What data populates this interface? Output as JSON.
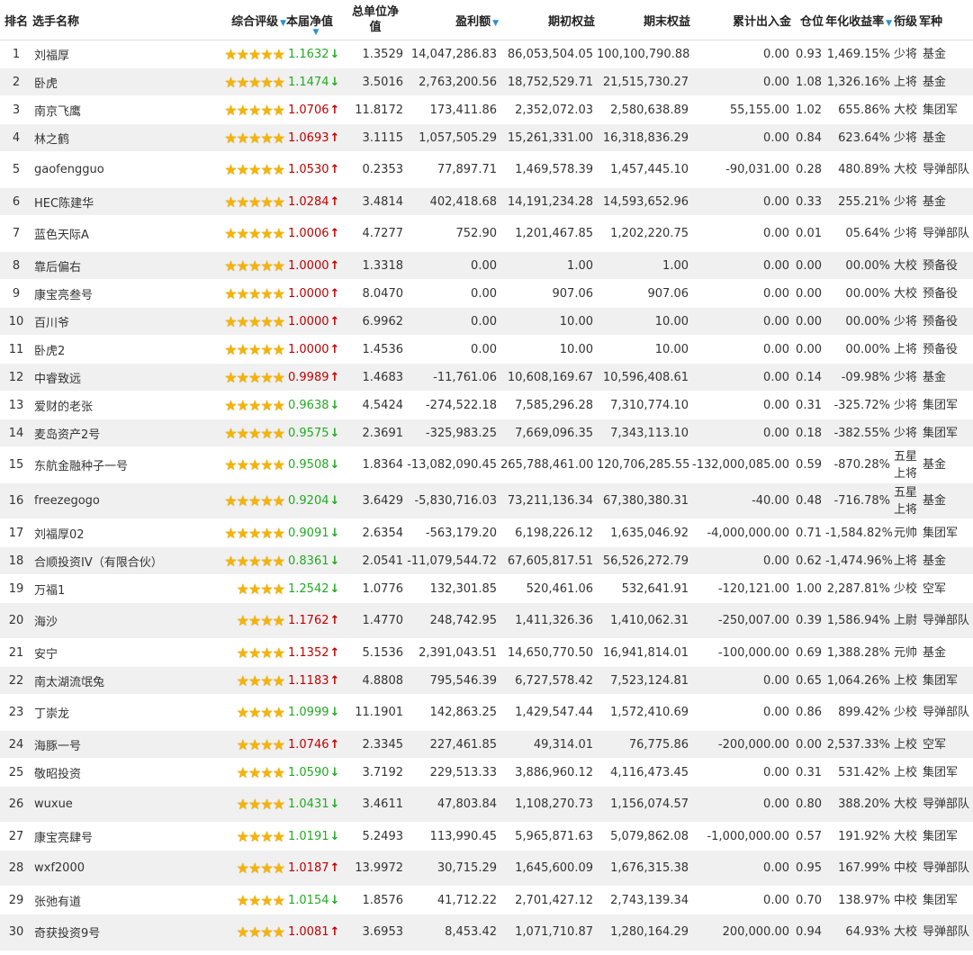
{
  "header": {
    "rank": "排名",
    "name": "选手名称",
    "rating": "综合评级",
    "nav": "本届净值",
    "total_nav_line1": "总单位净",
    "total_nav_line2": "值",
    "profit": "盈利额",
    "begin_equity": "期初权益",
    "end_equity": "期末权益",
    "cum_flow": "累计出入金",
    "position": "仓位",
    "annual_return": "年化收益率",
    "rank_title": "衔级",
    "branch": "军种",
    "sort_icon": "▼"
  },
  "colors": {
    "up": "#c00000",
    "down": "#22aa22",
    "star": "#f5b400",
    "stripe": "#f0f0f0",
    "sort": "#2a8fd8"
  },
  "rows": [
    {
      "rank": "1",
      "name": "刘福厚",
      "stars": 5,
      "nav": "1.1632",
      "dir": "down",
      "total_nav": "1.3529",
      "profit": "14,047,286.83",
      "begin": "86,053,504.05",
      "end": "100,100,790.88",
      "flow": "0.00",
      "position": "0.93",
      "annual": "1,469.15%",
      "title": "少将",
      "branch": "基金"
    },
    {
      "rank": "2",
      "name": "卧虎",
      "stars": 5,
      "nav": "1.1474",
      "dir": "down",
      "total_nav": "3.5016",
      "profit": "2,763,200.56",
      "begin": "18,752,529.71",
      "end": "21,515,730.27",
      "flow": "0.00",
      "position": "1.08",
      "annual": "1,326.16%",
      "title": "上将",
      "branch": "基金"
    },
    {
      "rank": "3",
      "name": "南京飞鹰",
      "stars": 5,
      "nav": "1.0706",
      "dir": "up",
      "total_nav": "11.8172",
      "profit": "173,411.86",
      "begin": "2,352,072.03",
      "end": "2,580,638.89",
      "flow": "55,155.00",
      "position": "1.02",
      "annual": "655.86%",
      "title": "大校",
      "branch": "集团军"
    },
    {
      "rank": "4",
      "name": "林之鹤",
      "stars": 5,
      "nav": "1.0693",
      "dir": "up",
      "total_nav": "3.1115",
      "profit": "1,057,505.29",
      "begin": "15,261,331.00",
      "end": "16,318,836.29",
      "flow": "0.00",
      "position": "0.84",
      "annual": "623.64%",
      "title": "少将",
      "branch": "基金"
    },
    {
      "rank": "5",
      "name": "gaofengguo",
      "stars": 5,
      "nav": "1.0530",
      "dir": "up",
      "total_nav": "0.2353",
      "profit": "77,897.71",
      "begin": "1,469,578.39",
      "end": "1,457,445.10",
      "flow": "-90,031.00",
      "position": "0.28",
      "annual": "480.89%",
      "title": "大校",
      "branch": "导弹部队"
    },
    {
      "rank": "6",
      "name": "HEC陈建华",
      "stars": 5,
      "nav": "1.0284",
      "dir": "up",
      "total_nav": "3.4814",
      "profit": "402,418.68",
      "begin": "14,191,234.28",
      "end": "14,593,652.96",
      "flow": "0.00",
      "position": "0.33",
      "annual": "255.21%",
      "title": "少将",
      "branch": "基金"
    },
    {
      "rank": "7",
      "name": "蓝色天际A",
      "stars": 5,
      "nav": "1.0006",
      "dir": "up",
      "total_nav": "4.7277",
      "profit": "752.90",
      "begin": "1,201,467.85",
      "end": "1,202,220.75",
      "flow": "0.00",
      "position": "0.01",
      "annual": "05.64%",
      "title": "少将",
      "branch": "导弹部队"
    },
    {
      "rank": "8",
      "name": "靠后偏右",
      "stars": 5,
      "nav": "1.0000",
      "dir": "up",
      "total_nav": "1.3318",
      "profit": "0.00",
      "begin": "1.00",
      "end": "1.00",
      "flow": "0.00",
      "position": "0.00",
      "annual": "00.00%",
      "title": "大校",
      "branch": "预备役"
    },
    {
      "rank": "9",
      "name": "康宝亮叁号",
      "stars": 5,
      "nav": "1.0000",
      "dir": "up",
      "total_nav": "8.0470",
      "profit": "0.00",
      "begin": "907.06",
      "end": "907.06",
      "flow": "0.00",
      "position": "0.00",
      "annual": "00.00%",
      "title": "大校",
      "branch": "预备役"
    },
    {
      "rank": "10",
      "name": "百川爷",
      "stars": 5,
      "nav": "1.0000",
      "dir": "up",
      "total_nav": "6.9962",
      "profit": "0.00",
      "begin": "10.00",
      "end": "10.00",
      "flow": "0.00",
      "position": "0.00",
      "annual": "00.00%",
      "title": "少将",
      "branch": "预备役"
    },
    {
      "rank": "11",
      "name": "卧虎2",
      "stars": 5,
      "nav": "1.0000",
      "dir": "up",
      "total_nav": "1.4536",
      "profit": "0.00",
      "begin": "10.00",
      "end": "10.00",
      "flow": "0.00",
      "position": "0.00",
      "annual": "00.00%",
      "title": "上将",
      "branch": "预备役"
    },
    {
      "rank": "12",
      "name": "中睿致远",
      "stars": 5,
      "nav": "0.9989",
      "dir": "up",
      "total_nav": "1.4683",
      "profit": "-11,761.06",
      "begin": "10,608,169.67",
      "end": "10,596,408.61",
      "flow": "0.00",
      "position": "0.14",
      "annual": "-09.98%",
      "title": "少将",
      "branch": "基金"
    },
    {
      "rank": "13",
      "name": "爱财的老张",
      "stars": 5,
      "nav": "0.9638",
      "dir": "down",
      "total_nav": "4.5424",
      "profit": "-274,522.18",
      "begin": "7,585,296.28",
      "end": "7,310,774.10",
      "flow": "0.00",
      "position": "0.31",
      "annual": "-325.72%",
      "title": "少将",
      "branch": "集团军"
    },
    {
      "rank": "14",
      "name": "麦岛资产2号",
      "stars": 5,
      "nav": "0.9575",
      "dir": "down",
      "total_nav": "2.3691",
      "profit": "-325,983.25",
      "begin": "7,669,096.35",
      "end": "7,343,113.10",
      "flow": "0.00",
      "position": "0.18",
      "annual": "-382.55%",
      "title": "少将",
      "branch": "集团军"
    },
    {
      "rank": "15",
      "name": "东航金融种子一号",
      "stars": 5,
      "nav": "0.9508",
      "dir": "down",
      "total_nav": "1.8364",
      "profit": "-13,082,090.45",
      "begin": "265,788,461.00",
      "end": "120,706,285.55",
      "flow": "-132,000,085.00",
      "position": "0.59",
      "annual": "-870.28%",
      "title": "五星上将",
      "branch": "基金"
    },
    {
      "rank": "16",
      "name": "freezegogo",
      "stars": 5,
      "nav": "0.9204",
      "dir": "down",
      "total_nav": "3.6429",
      "profit": "-5,830,716.03",
      "begin": "73,211,136.34",
      "end": "67,380,380.31",
      "flow": "-40.00",
      "position": "0.48",
      "annual": "-716.78%",
      "title": "五星上将",
      "branch": "基金"
    },
    {
      "rank": "17",
      "name": "刘福厚02",
      "stars": 5,
      "nav": "0.9091",
      "dir": "down",
      "total_nav": "2.6354",
      "profit": "-563,179.20",
      "begin": "6,198,226.12",
      "end": "1,635,046.92",
      "flow": "-4,000,000.00",
      "position": "0.71",
      "annual": "-1,584.82%",
      "title": "元帅",
      "branch": "集团军"
    },
    {
      "rank": "18",
      "name": "合顺投资IV（有限合伙）",
      "stars": 5,
      "nav": "0.8361",
      "dir": "down",
      "total_nav": "2.0541",
      "profit": "-11,079,544.72",
      "begin": "67,605,817.51",
      "end": "56,526,272.79",
      "flow": "0.00",
      "position": "0.62",
      "annual": "-1,474.96%",
      "title": "上将",
      "branch": "基金"
    },
    {
      "rank": "19",
      "name": "万福1",
      "stars": 4,
      "nav": "1.2542",
      "dir": "down",
      "total_nav": "1.0776",
      "profit": "132,301.85",
      "begin": "520,461.06",
      "end": "532,641.91",
      "flow": "-120,121.00",
      "position": "1.00",
      "annual": "2,287.81%",
      "title": "少校",
      "branch": "空军"
    },
    {
      "rank": "20",
      "name": "海沙",
      "stars": 4,
      "nav": "1.1762",
      "dir": "up",
      "total_nav": "1.4770",
      "profit": "248,742.95",
      "begin": "1,411,326.36",
      "end": "1,410,062.31",
      "flow": "-250,007.00",
      "position": "0.39",
      "annual": "1,586.94%",
      "title": "上尉",
      "branch": "导弹部队"
    },
    {
      "rank": "21",
      "name": "安宁",
      "stars": 4,
      "nav": "1.1352",
      "dir": "up",
      "total_nav": "5.1536",
      "profit": "2,391,043.51",
      "begin": "14,650,770.50",
      "end": "16,941,814.01",
      "flow": "-100,000.00",
      "position": "0.69",
      "annual": "1,388.28%",
      "title": "元帅",
      "branch": "基金"
    },
    {
      "rank": "22",
      "name": "南太湖流氓兔",
      "stars": 4,
      "nav": "1.1183",
      "dir": "up",
      "total_nav": "4.8808",
      "profit": "795,546.39",
      "begin": "6,727,578.42",
      "end": "7,523,124.81",
      "flow": "0.00",
      "position": "0.65",
      "annual": "1,064.26%",
      "title": "上校",
      "branch": "集团军"
    },
    {
      "rank": "23",
      "name": "丁崇龙",
      "stars": 4,
      "nav": "1.0999",
      "dir": "down",
      "total_nav": "11.1901",
      "profit": "142,863.25",
      "begin": "1,429,547.44",
      "end": "1,572,410.69",
      "flow": "0.00",
      "position": "0.86",
      "annual": "899.42%",
      "title": "少校",
      "branch": "导弹部队"
    },
    {
      "rank": "24",
      "name": "海豚一号",
      "stars": 4,
      "nav": "1.0746",
      "dir": "up",
      "total_nav": "2.3345",
      "profit": "227,461.85",
      "begin": "49,314.01",
      "end": "76,775.86",
      "flow": "-200,000.00",
      "position": "0.00",
      "annual": "2,537.33%",
      "title": "上校",
      "branch": "空军"
    },
    {
      "rank": "25",
      "name": "敬昭投资",
      "stars": 4,
      "nav": "1.0590",
      "dir": "down",
      "total_nav": "3.7192",
      "profit": "229,513.33",
      "begin": "3,886,960.12",
      "end": "4,116,473.45",
      "flow": "0.00",
      "position": "0.31",
      "annual": "531.42%",
      "title": "上校",
      "branch": "集团军"
    },
    {
      "rank": "26",
      "name": "wuxue",
      "stars": 4,
      "nav": "1.0431",
      "dir": "down",
      "total_nav": "3.4611",
      "profit": "47,803.84",
      "begin": "1,108,270.73",
      "end": "1,156,074.57",
      "flow": "0.00",
      "position": "0.80",
      "annual": "388.20%",
      "title": "大校",
      "branch": "导弹部队"
    },
    {
      "rank": "27",
      "name": "康宝亮肆号",
      "stars": 4,
      "nav": "1.0191",
      "dir": "down",
      "total_nav": "5.2493",
      "profit": "113,990.45",
      "begin": "5,965,871.63",
      "end": "5,079,862.08",
      "flow": "-1,000,000.00",
      "position": "0.57",
      "annual": "191.92%",
      "title": "大校",
      "branch": "集团军"
    },
    {
      "rank": "28",
      "name": "wxf2000",
      "stars": 4,
      "nav": "1.0187",
      "dir": "up",
      "total_nav": "13.9972",
      "profit": "30,715.29",
      "begin": "1,645,600.09",
      "end": "1,676,315.38",
      "flow": "0.00",
      "position": "0.95",
      "annual": "167.99%",
      "title": "中校",
      "branch": "导弹部队"
    },
    {
      "rank": "29",
      "name": "张弛有道",
      "stars": 4,
      "nav": "1.0154",
      "dir": "down",
      "total_nav": "1.8576",
      "profit": "41,712.22",
      "begin": "2,701,427.12",
      "end": "2,743,139.34",
      "flow": "0.00",
      "position": "0.70",
      "annual": "138.97%",
      "title": "中校",
      "branch": "集团军"
    },
    {
      "rank": "30",
      "name": "奇获投资9号",
      "stars": 4,
      "nav": "1.0081",
      "dir": "up",
      "total_nav": "3.6953",
      "profit": "8,453.42",
      "begin": "1,071,710.87",
      "end": "1,280,164.29",
      "flow": "200,000.00",
      "position": "0.94",
      "annual": "64.93%",
      "title": "大校",
      "branch": "导弹部队"
    }
  ]
}
